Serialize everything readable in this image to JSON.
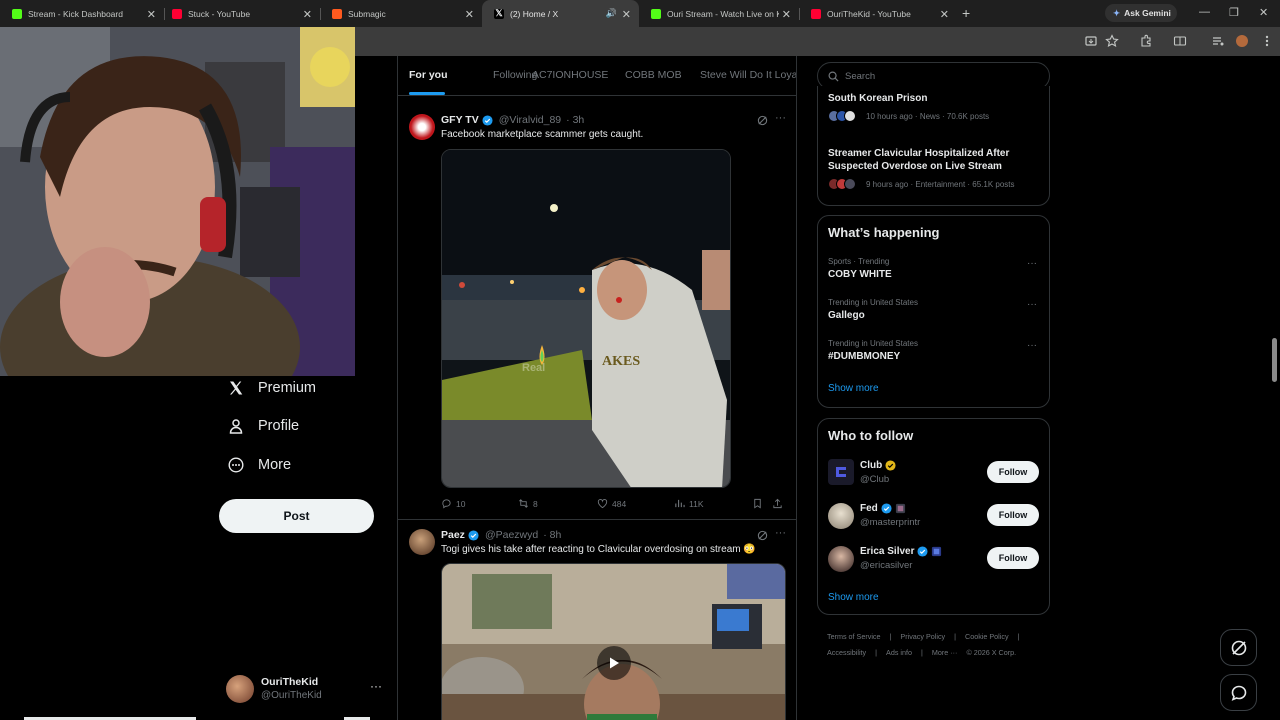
{
  "browser": {
    "tabs": [
      {
        "title": "Stream - Kick Dashboard",
        "favicon_color": "#53fc18"
      },
      {
        "title": "Stuck - YouTube",
        "favicon_color": "#ff0033"
      },
      {
        "title": "Submagic",
        "favicon_color": "#ff5a1f"
      },
      {
        "title": "(2) Home / X",
        "favicon_color": "#e7e9ea"
      },
      {
        "title": "Ouri Stream - Watch Live on Kick",
        "favicon_color": "#53fc18"
      },
      {
        "title": "OuriTheKid - YouTube",
        "favicon_color": "#ff0033"
      }
    ],
    "gemini_label": "Ask Gemini",
    "minimize": "—",
    "restore": "❐",
    "close": "✕",
    "newtab": "+"
  },
  "nav": {
    "premium": "Premium",
    "profile": "Profile",
    "more": "More",
    "post": "Post"
  },
  "account": {
    "name": "OuriTheKid",
    "handle": "@OuriTheKid",
    "more": "···"
  },
  "feed_tabs": [
    "For you",
    "Following",
    "AC7IONHOUSE",
    "COBB MOB",
    "Steve Will Do It Loyal"
  ],
  "tweets": [
    {
      "name": "GFY TV",
      "handle": "@Viralvid_89",
      "time": "· 3h",
      "text": "Facebook marketplace scammer gets caught.",
      "replies": "10",
      "reposts": "8",
      "likes": "484",
      "views": "11K",
      "video_caption": "Real"
    },
    {
      "name": "Paez",
      "handle": "@Paezwyd",
      "time": "· 8h",
      "text": "Togi gives his take after reacting to Clavicular overdosing on stream 😳"
    }
  ],
  "search": {
    "placeholder": "Search"
  },
  "news": [
    {
      "title": "South Korean Prison",
      "meta": "10 hours ago · News · 70.6K posts"
    },
    {
      "title": "Streamer Clavicular Hospitalized After Suspected Overdose on Live Stream",
      "meta": "9 hours ago · Entertainment · 65.1K posts"
    }
  ],
  "happening": {
    "heading": "What’s happening",
    "trends": [
      {
        "meta": "Sports · Trending",
        "name": "COBY WHITE"
      },
      {
        "meta": "Trending in United States",
        "name": "Gallego"
      },
      {
        "meta": "Trending in United States",
        "name": "#DUMBMONEY"
      }
    ],
    "show_more": "Show more"
  },
  "who_to_follow": {
    "heading": "Who to follow",
    "accounts": [
      {
        "name": "Club",
        "handle": "@Club",
        "button": "Follow"
      },
      {
        "name": "Fed",
        "handle": "@masterprintr",
        "button": "Follow"
      },
      {
        "name": "Erica Silver",
        "handle": "@ericasilver",
        "button": "Follow"
      }
    ],
    "show_more": "Show more"
  },
  "footer": [
    "Terms of Service",
    "|",
    "Privacy Policy",
    "|",
    "Cookie Policy",
    "|",
    "Accessibility",
    "|",
    "Ads info",
    "|",
    "More ···",
    "© 2026 X Corp."
  ],
  "colors": {
    "accent": "#1d9bf0",
    "verified": "#1d9bf0",
    "gold_badge": "#e2b719",
    "background": "#000000"
  }
}
